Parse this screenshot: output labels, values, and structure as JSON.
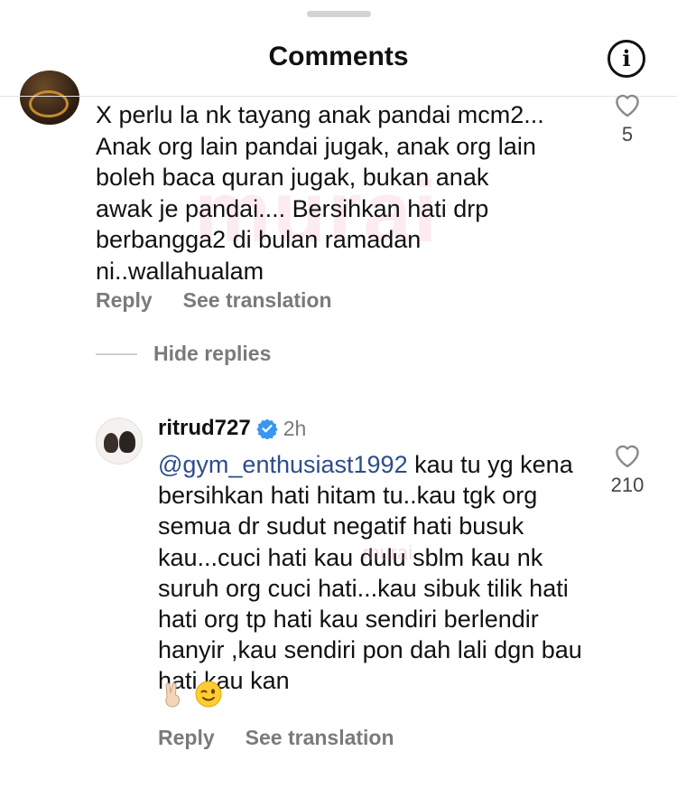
{
  "header": {
    "title": "Comments",
    "info_icon": "info-icon"
  },
  "comment": {
    "text": "X perlu la nk tayang anak pandai mcm2...\nAnak org lain pandai jugak, anak org lain\nboleh baca quran jugak, bukan anak\nawak je pandai.... Bersihkan hati drp\nberbangga2 di bulan ramadan\nni..wallahualam",
    "like_count": "5",
    "reply_label": "Reply",
    "translate_label": "See translation"
  },
  "replies_toggle": {
    "label": "Hide replies"
  },
  "reply": {
    "username": "ritrud727",
    "time": "2h",
    "mention": "@gym_enthusiast1992",
    "text": " kau tu yg kena bersihkan hati hitam tu..kau tgk org semua dr sudut negatif hati busuk kau...cuci hati kau dulu sblm kau nk suruh org cuci hati...kau sibuk tilik hati hati org tp hati kau sendiri berlendir hanyir ,kau sendiri pon dah lali dgn bau hati kau kan",
    "emojis": [
      "victory-hand-emoji",
      "winking-face-emoji"
    ],
    "like_count": "210",
    "reply_label": "Reply",
    "translate_label": "See translation"
  },
  "watermark": {
    "text": "murai",
    "small_text": "murai"
  },
  "colors": {
    "text": "#111111",
    "secondary": "#7a7a7a",
    "mention": "#2c4d8c",
    "verified": "#3897f0",
    "divider": "#e4e4e4"
  }
}
